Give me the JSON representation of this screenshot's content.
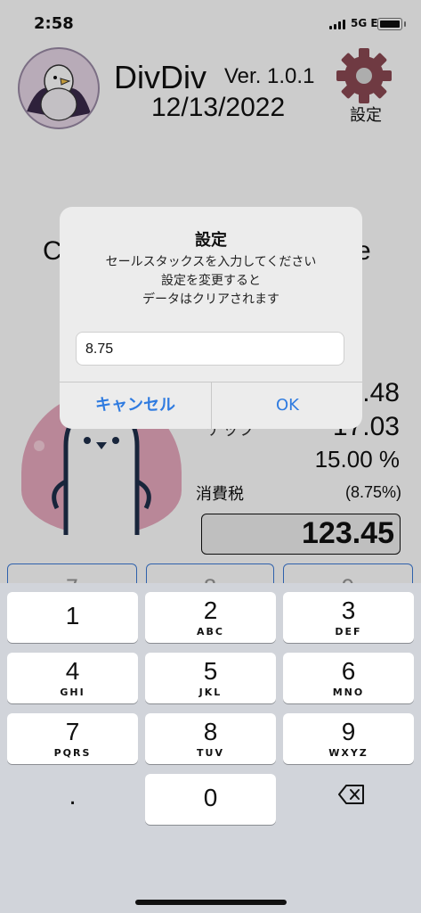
{
  "status": {
    "time": "2:58",
    "network": "5G E"
  },
  "header": {
    "app_name": "DivDiv",
    "version": "Ver. 1.0.1",
    "date": "12/13/2022",
    "settings_label": "設定"
  },
  "background": {
    "left_partial": "C",
    "right_partial": "e",
    "value_partial_1": ".48",
    "tip_label_partial": "チップ",
    "value_partial_2": "17.03",
    "tip_percent": "15.00 %",
    "tax_label": "消費税",
    "tax_rate": "(8.75%)",
    "total": "123.45",
    "tab_hints": [
      "7",
      "8",
      "9"
    ]
  },
  "dialog": {
    "title": "設定",
    "message_lines": [
      "セールスタックスを入力してください",
      "設定を変更すると",
      "データはクリアされます"
    ],
    "input_value": "8.75",
    "cancel_label": "キャンセル",
    "ok_label": "OK"
  },
  "keypad": {
    "keys": [
      {
        "num": "1",
        "letters": ""
      },
      {
        "num": "2",
        "letters": "ABC"
      },
      {
        "num": "3",
        "letters": "DEF"
      },
      {
        "num": "4",
        "letters": "GHI"
      },
      {
        "num": "5",
        "letters": "JKL"
      },
      {
        "num": "6",
        "letters": "MNO"
      },
      {
        "num": "7",
        "letters": "PQRS"
      },
      {
        "num": "8",
        "letters": "TUV"
      },
      {
        "num": "9",
        "letters": "WXYZ"
      }
    ],
    "dot": ".",
    "zero": "0"
  },
  "colors": {
    "accent": "#2f7be0",
    "gear": "#8b4953",
    "keyboard_bg": "#d1d4da"
  }
}
